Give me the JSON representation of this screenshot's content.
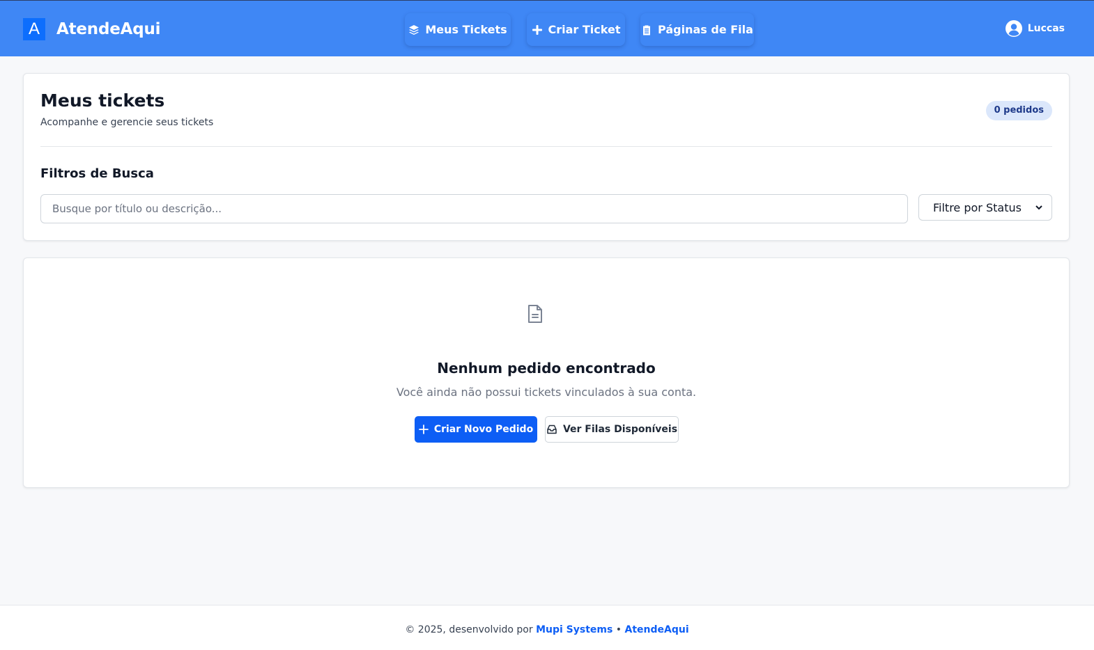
{
  "header": {
    "logo_letter": "A",
    "app_name": "AtendeAqui",
    "nav": [
      {
        "label": "Meus Tickets",
        "icon": "layers-icon"
      },
      {
        "label": "Criar Ticket",
        "icon": "plus-icon"
      },
      {
        "label": "Páginas de Fila",
        "icon": "clipboard-icon"
      }
    ],
    "user_name": "Luccas",
    "colors": {
      "bar": "#3f87f5",
      "logo": "#0d6efd"
    }
  },
  "tickets_card": {
    "title": "Meus tickets",
    "subtitle": "Acompanhe e gerencie seus tickets",
    "count_badge": "0 pedidos",
    "filters_title": "Filtros de Busca",
    "search_placeholder": "Busque por título ou descrição...",
    "status_select": "Filtre por Status"
  },
  "empty_state": {
    "icon": "document-icon",
    "title": "Nenhum pedido encontrado",
    "message": "Você ainda não possui tickets vinculados à sua conta.",
    "primary_button": "Criar Novo Pedido",
    "secondary_button": "Ver Filas Disponíveis",
    "primary_color": "#0d5ef5"
  },
  "footer": {
    "prefix": "© 2025, desenvolvido por",
    "company": "Mupi Systems",
    "separator": "•",
    "app": "AtendeAqui"
  }
}
